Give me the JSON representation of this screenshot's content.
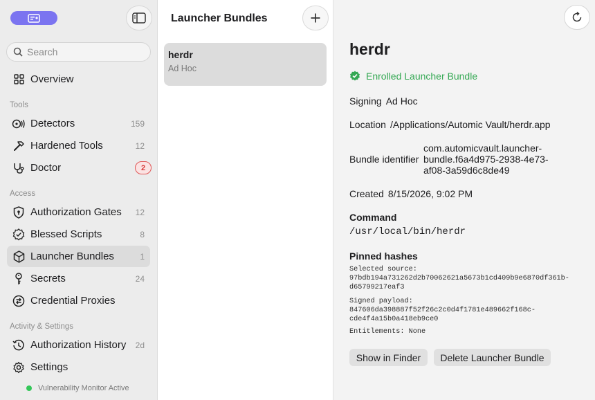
{
  "sidebar": {
    "search_placeholder": "Search",
    "overview_label": "Overview",
    "sections": {
      "tools": "Tools",
      "access": "Access",
      "activity": "Activity & Settings"
    },
    "items": {
      "detectors": {
        "label": "Detectors",
        "count": "159"
      },
      "hardened_tools": {
        "label": "Hardened Tools",
        "count": "12"
      },
      "doctor": {
        "label": "Doctor",
        "badge": "2"
      },
      "authorization_gates": {
        "label": "Authorization Gates",
        "count": "12"
      },
      "blessed_scripts": {
        "label": "Blessed Scripts",
        "count": "8"
      },
      "launcher_bundles": {
        "label": "Launcher Bundles",
        "count": "1"
      },
      "secrets": {
        "label": "Secrets",
        "count": "24"
      },
      "credential_proxies": {
        "label": "Credential Proxies"
      },
      "authorization_history": {
        "label": "Authorization History",
        "count": "2d"
      },
      "settings": {
        "label": "Settings"
      }
    },
    "footer_status": "Vulnerability Monitor Active"
  },
  "list": {
    "title": "Launcher Bundles",
    "items": [
      {
        "name": "herdr",
        "signing": "Ad Hoc"
      }
    ]
  },
  "detail": {
    "title": "herdr",
    "status": "Enrolled Launcher Bundle",
    "signing_label": "Signing",
    "signing_value": "Ad Hoc",
    "location_label": "Location",
    "location_value": "/Applications/Automic Vault/herdr.app",
    "bundle_id_label": "Bundle identifier",
    "bundle_id_value": "com.automicvault.launcher-bundle.f6a4d975-2938-4e73-af08-3a59d6c8de49",
    "created_label": "Created",
    "created_value": "8/15/2026, 9:02 PM",
    "command_heading": "Command",
    "command_value": "/usr/local/bin/herdr",
    "pinned_heading": "Pinned hashes",
    "selected_source_label": "Selected source:",
    "selected_source_value": "97bdb194a731262d2b70062621a5673b1cd409b9e6870df361b-d65799217eaf3",
    "signed_payload_label": "Signed payload:",
    "signed_payload_value": "847606da398887f52f26c2c0d4f1781e489662f168c-cde4f4a15b0a418eb9ce0",
    "entitlements_label": "Entitlements:",
    "entitlements_value": "None",
    "show_in_finder": "Show in Finder",
    "delete_bundle": "Delete Launcher Bundle"
  },
  "colors": {
    "accent": "#7b74f0",
    "success": "#34a853",
    "badge_red": "#d83a3a",
    "status_dot": "#34c759"
  }
}
